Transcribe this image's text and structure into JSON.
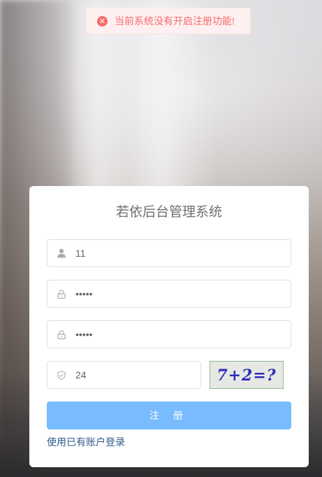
{
  "toast": {
    "icon": "error-circle-icon",
    "message": "当前系统没有开启注册功能!"
  },
  "form": {
    "title": "若依后台管理系统",
    "username": {
      "value": "11",
      "icon": "user-icon"
    },
    "password": {
      "value": "•••••",
      "icon": "lock-icon"
    },
    "confirm_password": {
      "value": "•••••",
      "icon": "lock-icon"
    },
    "captcha_input": {
      "value": "24",
      "icon": "shield-icon"
    },
    "captcha_image_text": "7+2=?",
    "register_label": "注 册",
    "login_link": "使用已有账户登录"
  },
  "colors": {
    "error": "#f56c6c",
    "primary_disabled": "#79bbff",
    "link": "#2f5a8a"
  }
}
